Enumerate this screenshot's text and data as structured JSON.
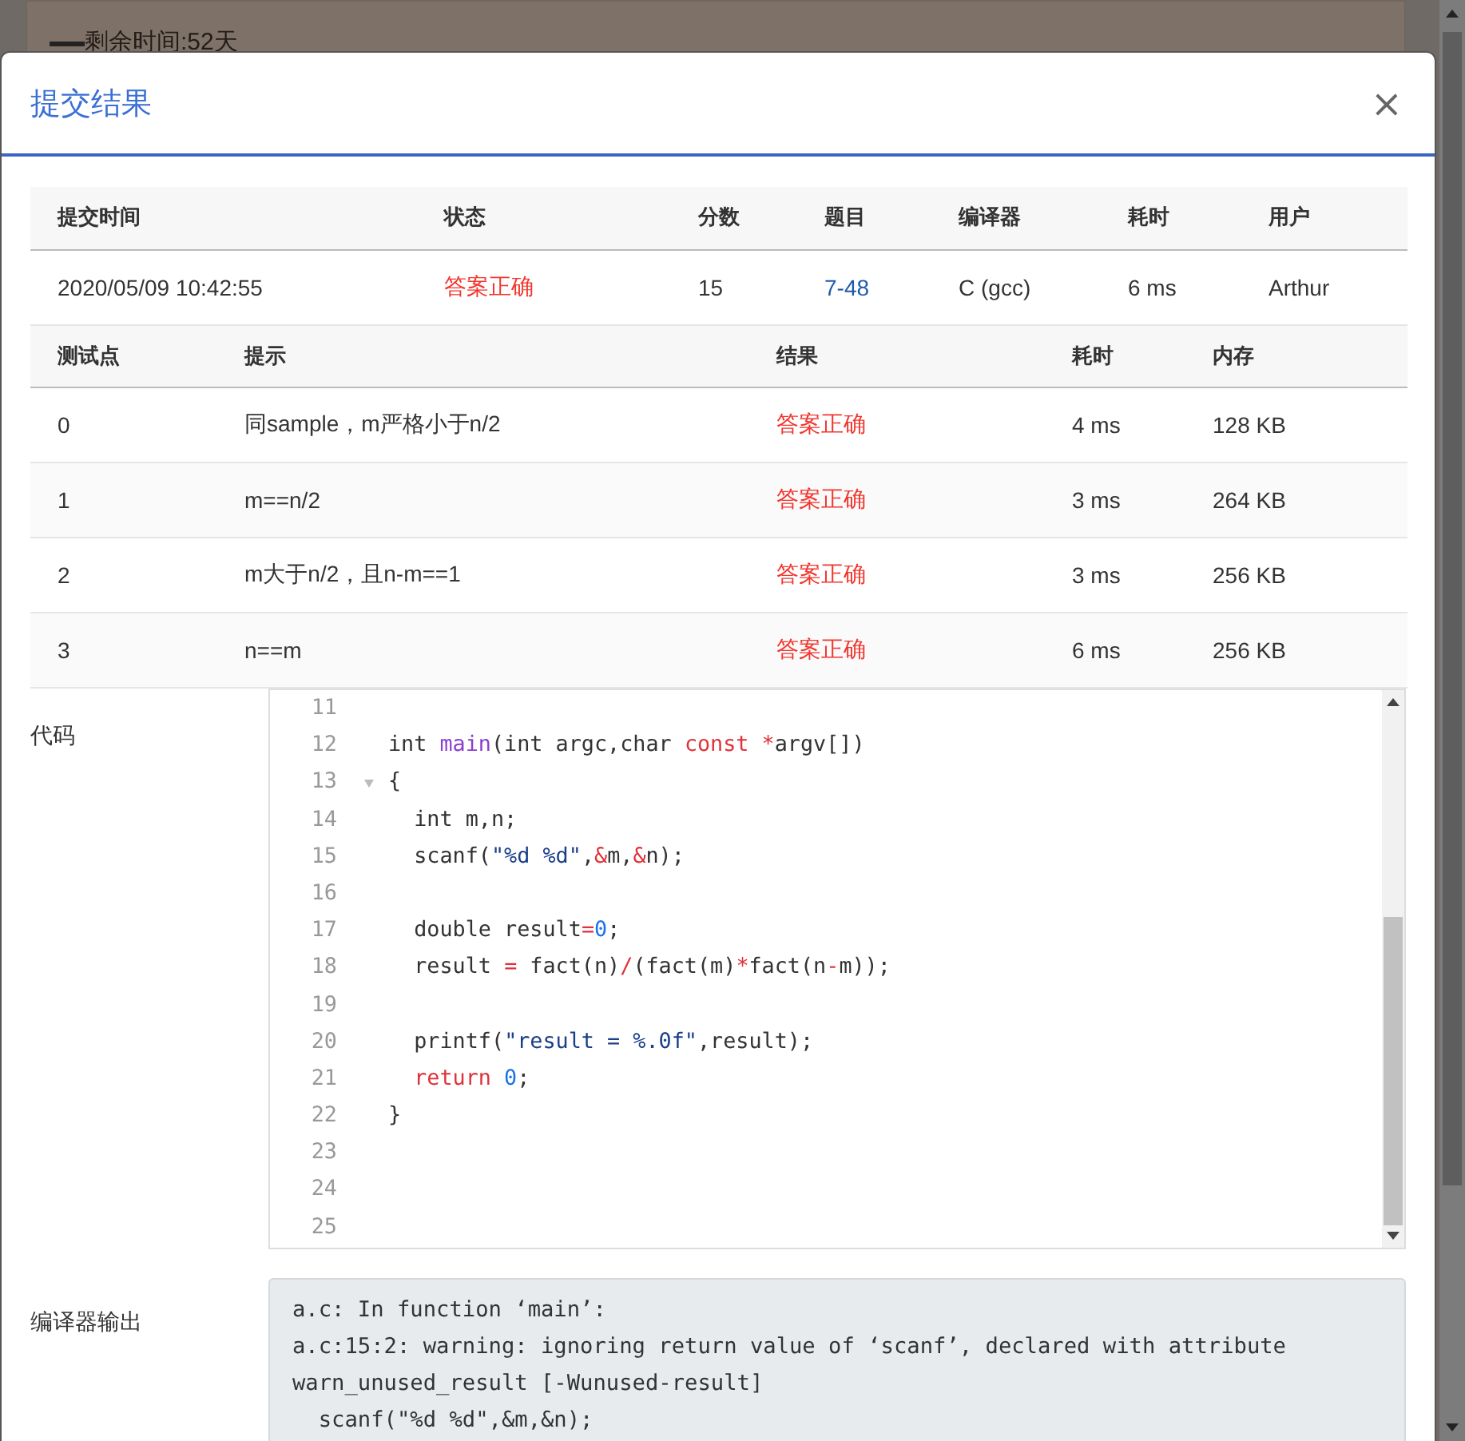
{
  "background": {
    "text": "剩余时间:52天"
  },
  "dialog": {
    "title": "提交结果",
    "close": "×"
  },
  "submission": {
    "columns": [
      "提交时间",
      "状态",
      "分数",
      "题目",
      "编译器",
      "耗时",
      "用户"
    ],
    "row": {
      "time": "2020/05/09 10:42:55",
      "status": "答案正确",
      "score": "15",
      "problem": "7-48",
      "compiler": "C (gcc)",
      "duration": "6 ms",
      "user": "Arthur"
    }
  },
  "tests": {
    "columns": [
      "测试点",
      "提示",
      "结果",
      "耗时",
      "内存"
    ],
    "rows": [
      {
        "id": "0",
        "hint": "同sample，m严格小于n/2",
        "result": "答案正确",
        "time": "4 ms",
        "memory": "128 KB"
      },
      {
        "id": "1",
        "hint": "m==n/2",
        "result": "答案正确",
        "time": "3 ms",
        "memory": "264 KB"
      },
      {
        "id": "2",
        "hint": "m大于n/2，且n-m==1",
        "result": "答案正确",
        "time": "3 ms",
        "memory": "256 KB"
      },
      {
        "id": "3",
        "hint": "n==m",
        "result": "答案正确",
        "time": "6 ms",
        "memory": "256 KB"
      }
    ]
  },
  "code": {
    "label": "代码",
    "lines": [
      {
        "number": "11",
        "fold": false
      },
      {
        "number": "12",
        "fold": false,
        "tokens": [
          {
            "text": "int ",
            "kind": "plain"
          },
          {
            "text": "main",
            "kind": "func"
          },
          {
            "text": "(int argc,char ",
            "kind": "plain"
          },
          {
            "text": "const",
            "kind": "keyword"
          },
          {
            "text": " *",
            "kind": "operator"
          },
          {
            "text": "argv[])",
            "kind": "plain"
          }
        ]
      },
      {
        "number": "13",
        "fold": true,
        "tokens": [
          {
            "text": "{",
            "kind": "plain"
          }
        ]
      },
      {
        "number": "14",
        "fold": false,
        "tokens": [
          {
            "text": "  int m,n;",
            "kind": "plain"
          }
        ]
      },
      {
        "number": "15",
        "fold": false,
        "tokens": [
          {
            "text": "  scanf(",
            "kind": "plain"
          },
          {
            "text": "\"%d %d\"",
            "kind": "string"
          },
          {
            "text": ",",
            "kind": "plain"
          },
          {
            "text": "&",
            "kind": "operator"
          },
          {
            "text": "m,",
            "kind": "plain"
          },
          {
            "text": "&",
            "kind": "operator"
          },
          {
            "text": "n);",
            "kind": "plain"
          }
        ]
      },
      {
        "number": "16",
        "fold": false
      },
      {
        "number": "17",
        "fold": false,
        "tokens": [
          {
            "text": "  double result",
            "kind": "plain"
          },
          {
            "text": "=",
            "kind": "operator"
          },
          {
            "text": "0",
            "kind": "number"
          },
          {
            "text": ";",
            "kind": "plain"
          }
        ]
      },
      {
        "number": "18",
        "fold": false,
        "tokens": [
          {
            "text": "  result ",
            "kind": "plain"
          },
          {
            "text": "=",
            "kind": "operator"
          },
          {
            "text": " fact(n)",
            "kind": "plain"
          },
          {
            "text": "/",
            "kind": "operator"
          },
          {
            "text": "(fact(m)",
            "kind": "plain"
          },
          {
            "text": "*",
            "kind": "operator"
          },
          {
            "text": "fact(n",
            "kind": "plain"
          },
          {
            "text": "-",
            "kind": "operator"
          },
          {
            "text": "m));",
            "kind": "plain"
          }
        ]
      },
      {
        "number": "19",
        "fold": false
      },
      {
        "number": "20",
        "fold": false,
        "tokens": [
          {
            "text": "  printf(",
            "kind": "plain"
          },
          {
            "text": "\"result = %.0f\"",
            "kind": "string"
          },
          {
            "text": ",result);",
            "kind": "plain"
          }
        ]
      },
      {
        "number": "21",
        "fold": false,
        "tokens": [
          {
            "text": "  return",
            "kind": "keyword"
          },
          {
            "text": " 0",
            "kind": "number"
          },
          {
            "text": ";",
            "kind": "plain"
          }
        ]
      },
      {
        "number": "22",
        "fold": false,
        "tokens": [
          {
            "text": "}",
            "kind": "plain"
          }
        ]
      },
      {
        "number": "23",
        "fold": false
      },
      {
        "number": "24",
        "fold": false
      },
      {
        "number": "25",
        "fold": false
      }
    ]
  },
  "compiler_output": {
    "label": "编译器输出",
    "lines": [
      "a.c: In function ‘main’:",
      "a.c:15:2: warning: ignoring return value of ‘scanf’, declared with attribute",
      "warn_unused_result [-Wunused-result]",
      "  scanf(\"%d %d\",&m,&n);"
    ]
  }
}
